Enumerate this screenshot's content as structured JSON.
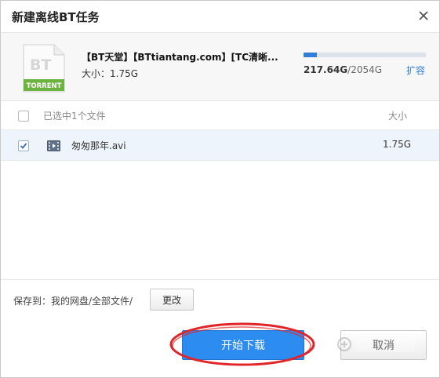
{
  "dialog": {
    "title": "新建离线BT任务",
    "close_icon": "close-icon"
  },
  "torrent": {
    "icon": "torrent-file-icon",
    "icon_badge": "BT",
    "icon_caption": "TORRENT",
    "name": "【BT天堂】【BTtiantang.com】[TC清晰...",
    "size_label": "大小：1.75G",
    "quota_used": "217.64G",
    "quota_total": "/2054G",
    "quota_fraction": 0.106,
    "expand_label": "扩容"
  },
  "file_list": {
    "header": {
      "selected_text": "已选中1个文件",
      "size_column": "大小",
      "checked": false
    },
    "rows": [
      {
        "name": "匆匆那年.avi",
        "size": "1.75G",
        "checked": true,
        "icon": "video-file-icon"
      }
    ]
  },
  "footer": {
    "save_to_label": "保存到：我的网盘/全部文件/",
    "change_button": "更改",
    "start_button": "开始下载",
    "cancel_button": "取消"
  },
  "colors": {
    "accent": "#2d8cf0",
    "link": "#2f7fd6",
    "annotation_circle": "#e0262a",
    "torrent_badge_green": "#6db33f"
  }
}
